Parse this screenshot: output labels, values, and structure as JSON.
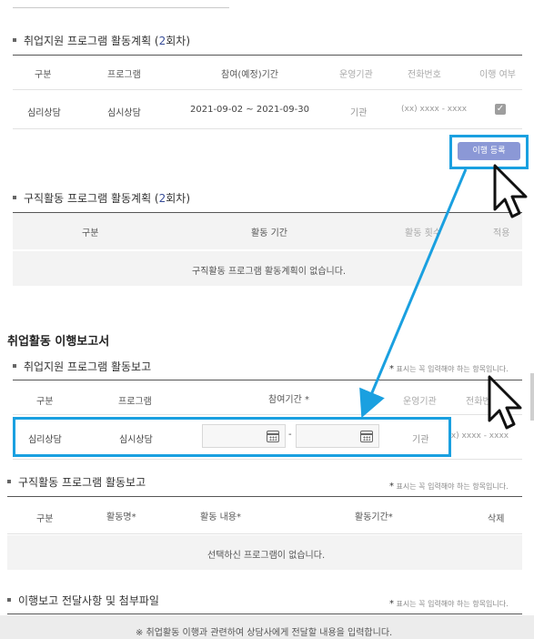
{
  "plan_section": {
    "title_prefix": "취업지원 프로그램 활동계획 (",
    "title_num": "2",
    "title_suffix": "회차)",
    "headers": [
      "구분",
      "프로그램",
      "참여(예정)기간",
      "운영기관",
      "전화번호",
      "이행 여부"
    ],
    "row": {
      "category": "심리상담",
      "program": "심시상담",
      "period": "2021-09-02 ~ 2021-09-30",
      "agency": "기관",
      "phone": "(xx) xxxx - xxxx"
    },
    "register_button": "이행 등록"
  },
  "job_search_plan": {
    "title_prefix": "구직활동 프로그램 활동계획 (",
    "title_num": "2",
    "title_suffix": "회차)",
    "headers": [
      "구분",
      "활동 기간",
      "활동 횟수",
      "적용"
    ],
    "empty_message": "구직활동 프로그램 활동계획이 없습니다."
  },
  "report": {
    "title": "취업활동 이행보고서",
    "required_note": "표시는 꼭 입력해야 하는 항목입니다.",
    "support_section": {
      "title": "취업지원 프로그램 활동보고",
      "headers": [
        "구분",
        "프로그램",
        "참여기간 *",
        "운영기관",
        "전화번호"
      ],
      "row": {
        "category": "심리상담",
        "program": "심시상담",
        "date_separator": "-",
        "agency": "기관",
        "phone": "(xx) xxxx - xxxx"
      }
    },
    "job_search_section": {
      "title": "구직활동 프로그램 활동보고",
      "headers": [
        "구분",
        "활동명*",
        "활동 내용*",
        "활동기간*",
        "삭제"
      ],
      "empty_message": "선택하신 프로그램이 없습니다."
    },
    "attachment_section": {
      "title": "이행보고 전달사항 및 첨부파일",
      "notice": "※ 취업활동 이행과 관련하여 상담사에게 전달할 내용을 입력합니다."
    }
  },
  "colors": {
    "accent_highlight": "#1aa0e0",
    "register_button_bg": "#8b98d6",
    "title_number": "#3a4f9a"
  }
}
